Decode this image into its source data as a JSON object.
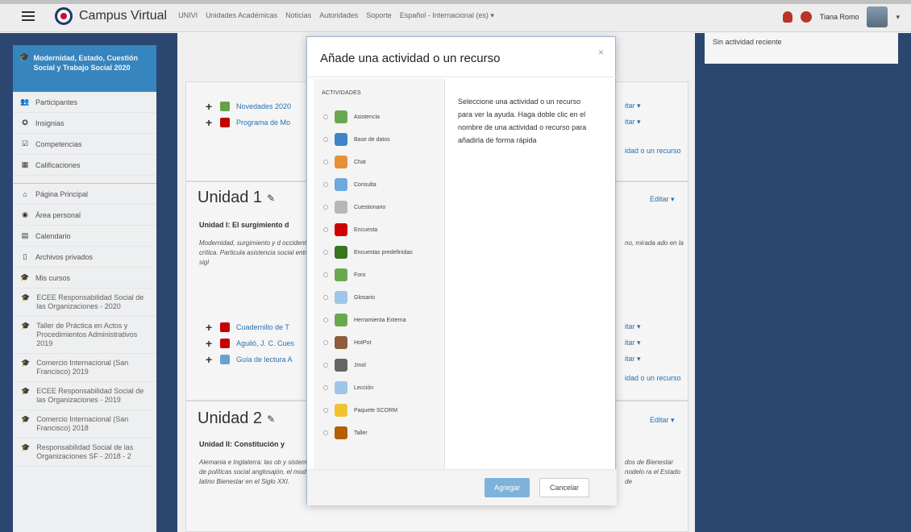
{
  "navbar": {
    "brand": "Campus Virtual",
    "menu": [
      "UNIVI",
      "Unidades Académicas",
      "Noticias",
      "Autoridades",
      "Soporte",
      "Español - Internacional (es) ▾"
    ],
    "user_name": "Tiana Romo",
    "icons": {
      "menu": "hamburger-icon",
      "notifications": "bell-icon",
      "messages": "chat-icon"
    }
  },
  "sidebar": {
    "course_title": "Modernidad, Estado, Cuestión Social y Trabajo Social 2020",
    "items": [
      {
        "icon": "users-icon",
        "label": "Participantes"
      },
      {
        "icon": "badge-icon",
        "label": "Insignias"
      },
      {
        "icon": "check-icon",
        "label": "Competencias"
      },
      {
        "icon": "grades-icon",
        "label": "Calificaciones"
      }
    ],
    "nav": [
      {
        "icon": "home-icon",
        "label": "Página Principal"
      },
      {
        "icon": "dashboard-icon",
        "label": "Área personal"
      },
      {
        "icon": "calendar-icon",
        "label": "Calendario"
      },
      {
        "icon": "file-icon",
        "label": "Archivos privados"
      },
      {
        "icon": "graduation-cap-icon",
        "label": "Mis cursos"
      }
    ],
    "courses": [
      "ECEE Responsabilidad Social de las Organizaciones - 2020",
      "Taller de Práctica en Actos y Procedimientos Administrativos 2019",
      "Comercio Internacional (San Francisco) 2019",
      "ECEE Responsabilidad Social de las Organizaciones - 2019",
      "Comercio Internacional (San Francisco) 2018",
      "Responsabilidad Social de las Organizaciones SF - 2018 - 2"
    ]
  },
  "main": {
    "section0": {
      "resources": [
        "Novedades 2020",
        "Programa de Mo"
      ],
      "edit_label": "itar ▾",
      "add_label": "idad o un recurso"
    },
    "unit1": {
      "title": "Unidad 1",
      "subtitle": "Unidad I: El surgimiento d",
      "desc_left": "Modernidad, surgimiento y d occidental y crítica. Particula asistencia social entre el sigl",
      "desc_right": "no, mirada ado en la",
      "edit": "Editar ▾",
      "resources": [
        "Cuadernillo de T",
        "Aguiló, J. C. Cues",
        "Guía de lectura A"
      ],
      "add_label": "idad o un recurso"
    },
    "unit2": {
      "title": "Unidad 2",
      "subtitle": "Unidad II: Constitución y",
      "desc_left": "Alemania e Inglaterra: las ob y sistemas de políticas social anglosajón, el modelo latino Bienestar en el Siglo XXI.",
      "desc_right": "dos de Bienestar nodelo ra el Estado de",
      "edit": "Editar ▾"
    }
  },
  "recent_activity": "Sin actividad reciente",
  "modal": {
    "title": "Añade una actividad o un recurso",
    "close": "×",
    "list_heading": "ACTIVIDADES",
    "items": [
      {
        "label": "Asistencia",
        "icon": "attendance-icon",
        "color": "#6aa84f"
      },
      {
        "label": "Base de datos",
        "icon": "database-icon",
        "color": "#3d85c6"
      },
      {
        "label": "Chat",
        "icon": "chat-icon",
        "color": "#e69138"
      },
      {
        "label": "Consulta",
        "icon": "question-icon",
        "color": "#6fa8dc"
      },
      {
        "label": "Cuestionario",
        "icon": "quiz-icon",
        "color": "#b7b7b7"
      },
      {
        "label": "Encuesta",
        "icon": "survey-icon",
        "color": "#cc0000"
      },
      {
        "label": "Encuestas predefinidas",
        "icon": "chart-icon",
        "color": "#38761d"
      },
      {
        "label": "Foro",
        "icon": "forum-icon",
        "color": "#6aa84f"
      },
      {
        "label": "Glosario",
        "icon": "glossary-icon",
        "color": "#9fc5e8"
      },
      {
        "label": "Herramienta Externa",
        "icon": "puzzle-icon",
        "color": "#6aa84f"
      },
      {
        "label": "HotPot",
        "icon": "hotpot-icon",
        "color": "#8e5b3c"
      },
      {
        "label": "Jmol",
        "icon": "molecule-icon",
        "color": "#666666"
      },
      {
        "label": "Lección",
        "icon": "lesson-icon",
        "color": "#9fc5e8"
      },
      {
        "label": "Paquete SCORM",
        "icon": "package-icon",
        "color": "#f1c232"
      },
      {
        "label": "Taller",
        "icon": "workshop-icon",
        "color": "#b45f06"
      }
    ],
    "help_text": "Seleccione una actividad o un recurso para ver la ayuda. Haga doble clic en el nombre de una actividad o recurso para añadirla de forma rápida",
    "add_button": "Agregar",
    "cancel_button": "Cancelar"
  }
}
